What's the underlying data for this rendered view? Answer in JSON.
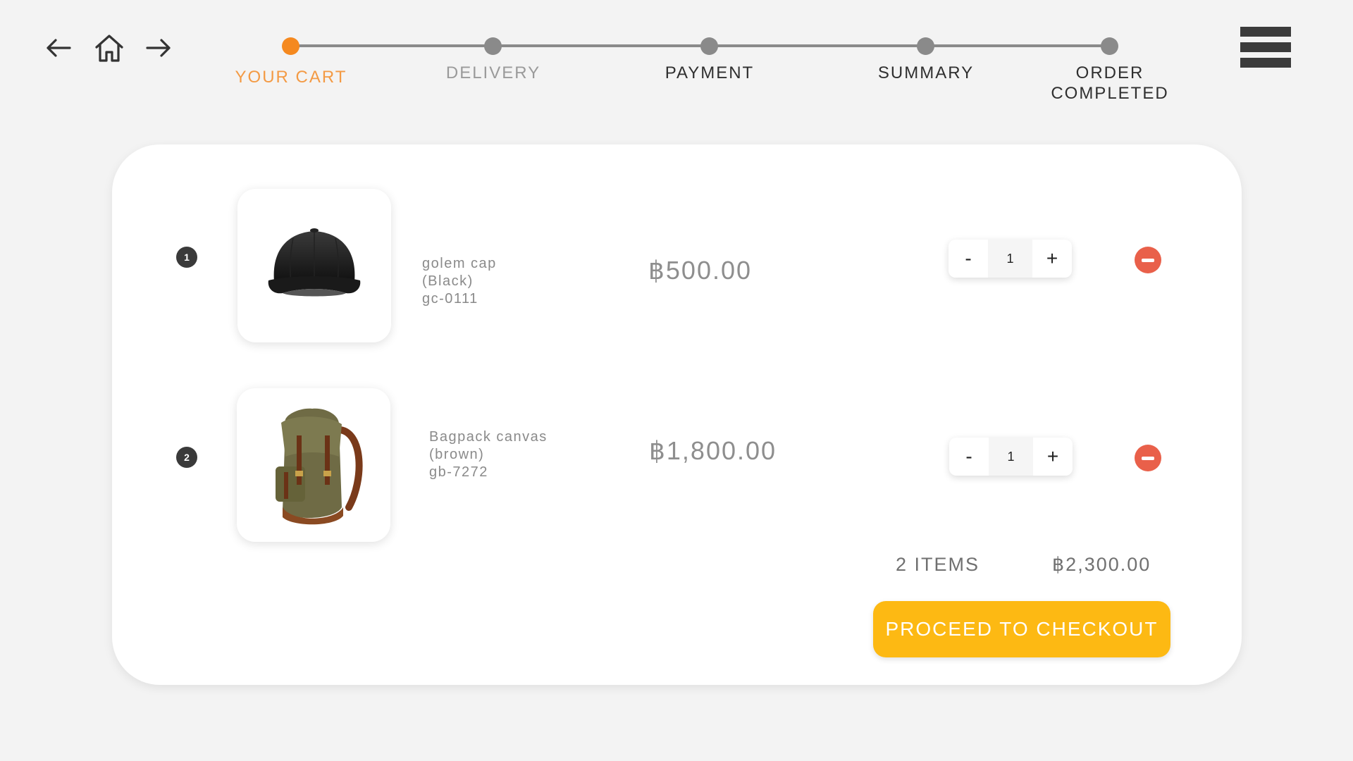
{
  "nav": {
    "back_icon": "arrow-left-icon",
    "home_icon": "home-icon",
    "forward_icon": "arrow-right-icon",
    "menu_icon": "hamburger-menu-icon"
  },
  "steps": [
    {
      "label": "YOUR CART",
      "state": "active"
    },
    {
      "label": "DELIVERY",
      "state": "muted"
    },
    {
      "label": "PAYMENT",
      "state": "default"
    },
    {
      "label": "SUMMARY",
      "state": "default"
    },
    {
      "label": "ORDER\nCOMPLETED",
      "state": "default"
    }
  ],
  "cart": {
    "items": [
      {
        "index": "1",
        "name": "golem cap",
        "variant": "(Black)",
        "sku": "gc-0111",
        "price": "฿500.00",
        "quantity": "1",
        "image_icon": "black-cap-image"
      },
      {
        "index": "2",
        "name": "Bagpack canvas",
        "variant": "(brown)",
        "sku": "gb-7272",
        "price": "฿1,800.00",
        "quantity": "1",
        "image_icon": "canvas-backpack-image"
      }
    ],
    "decrement_label": "-",
    "increment_label": "+",
    "item_count": "2 ITEMS",
    "total": "฿2,300.00",
    "checkout_label": "PROCEED TO CHECKOUT"
  },
  "colors": {
    "background": "#f3f3f3",
    "active_step": "#f5891f",
    "step_dot": "#8a8a8a",
    "remove": "#e9604a",
    "checkout": "#fdb913"
  }
}
